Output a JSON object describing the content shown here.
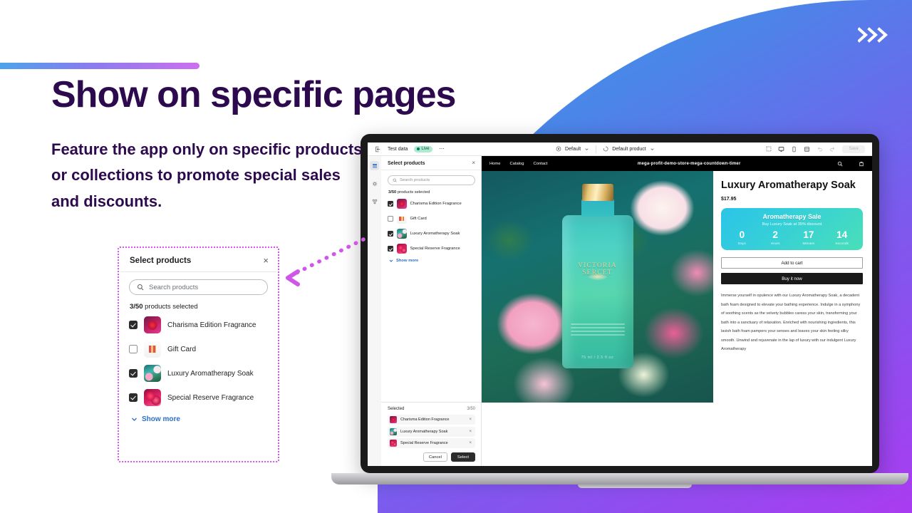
{
  "hero": {
    "headline": "Show on specific pages",
    "subhead": "Feature the app only on specific products or collections to promote special sales and discounts.",
    "chevrons_icon": "triple-chevron-right-icon"
  },
  "callout": {
    "title": "Select products",
    "close_label": "×",
    "search_placeholder": "Search products",
    "search_icon": "search-icon",
    "count_bold": "3/50",
    "count_rest": " products selected",
    "show_more": "Show more",
    "chevron_icon": "chevron-down-icon",
    "products": [
      {
        "name": "Charisma Edition Fragrance",
        "checked": true,
        "thumb": "t-charisma"
      },
      {
        "name": "Gift Card",
        "checked": false,
        "thumb": "t-gift"
      },
      {
        "name": "Luxury Aromatherapy Soak",
        "checked": true,
        "thumb": "t-soak"
      },
      {
        "name": "Special Reserve Fragrance",
        "checked": true,
        "thumb": "t-special"
      }
    ]
  },
  "laptop": {
    "toolbar": {
      "test_data": "Test data",
      "live_badge": "Live",
      "more_icon": "ellipsis-icon",
      "theme_label": "Default",
      "theme_icon": "theme-icon",
      "template_label": "Default product",
      "template_icon": "template-icon",
      "view_icons": [
        "inspector-icon",
        "desktop-view-icon",
        "mobile-view-icon",
        "fullscreen-view-icon"
      ],
      "undo_icon": "undo-icon",
      "redo_icon": "redo-icon",
      "save_label": "Save"
    },
    "rail_icons": [
      "sections-icon",
      "settings-gear-icon",
      "apps-icon"
    ],
    "panel": {
      "title": "Select products",
      "close_label": "×",
      "search_placeholder": "Search products",
      "count_bold": "3/50",
      "count_rest": " products selected",
      "show_more": "Show more",
      "products": [
        {
          "name": "Charisma Edition Fragrance",
          "checked": true,
          "thumb": "t-charisma"
        },
        {
          "name": "Gift Card",
          "checked": false,
          "thumb": "t-gift"
        },
        {
          "name": "Luxury Aromatherapy Soak",
          "checked": true,
          "thumb": "t-soak"
        },
        {
          "name": "Special Reserve Fragrance",
          "checked": true,
          "thumb": "t-special"
        }
      ],
      "footer": {
        "heading": "Selected",
        "count": "3/50",
        "items": [
          {
            "name": "Charisma Edition Fragrance",
            "thumb": "t-charisma",
            "remove": "×"
          },
          {
            "name": "Luxury Aromatherapy Soak",
            "thumb": "t-soak",
            "remove": "×"
          },
          {
            "name": "Special Reserve Fragrance",
            "thumb": "t-special",
            "remove": "×"
          }
        ],
        "cancel_label": "Cancel",
        "select_label": "Select"
      }
    },
    "store": {
      "nav": [
        "Home",
        "Catalog",
        "Contact"
      ],
      "brand": "mega-profit-demo-store-mega-countdown-timer",
      "search_icon": "search-icon",
      "cart_icon": "cart-icon",
      "product_image": {
        "brand_text": "VICTORIA SERCET",
        "volume_text": "75 ml / 2.5 fl.oz"
      },
      "pdp": {
        "title": "Luxury Aromatherapy Soak",
        "price": "$17.95",
        "timer": {
          "heading": "Aromatherapy Sale",
          "subheading": "Buy Luxury Soak at 35% discount",
          "units": [
            {
              "value": "0",
              "label": "Days"
            },
            {
              "value": "2",
              "label": "Hours"
            },
            {
              "value": "17",
              "label": "Minutes"
            },
            {
              "value": "14",
              "label": "Seconds"
            }
          ]
        },
        "add_to_cart": "Add to cart",
        "buy_it_now": "Buy it now",
        "description": "Immerse yourself in opulence with our Luxury Aromatherapy Soak, a decadent bath foam designed to elevate your bathing experience. Indulge in a symphony of soothing scents as the velvety bubbles caress your skin, transforming your bath into a sanctuary of relaxation. Enriched with nourishing ingredients, this lavish bath foam pampers your senses and leaves your skin feeling silky smooth. Unwind and rejuvenate in the lap of luxury with our indulgent Luxury Aromatherapy"
      }
    }
  },
  "colors": {
    "brand_purple": "#2d0a4e",
    "accent_magenta": "#cf56e8",
    "bg_blue": "#3d9bec",
    "bg_purple": "#a93cf0",
    "link_blue": "#2c6ecb",
    "timer_cyan": "#2bc4e8"
  }
}
